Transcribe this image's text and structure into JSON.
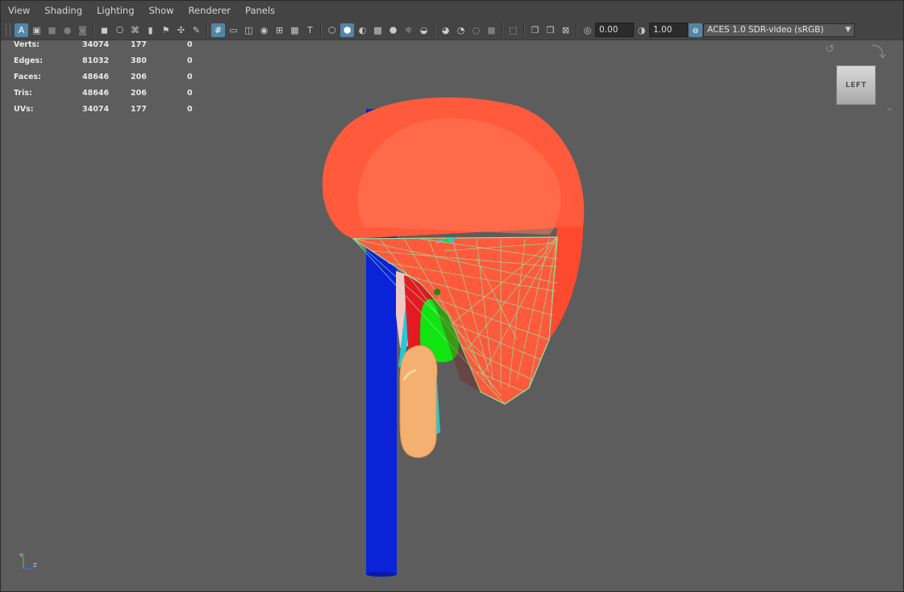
{
  "menu": [
    "View",
    "Shading",
    "Lighting",
    "Show",
    "Renderer",
    "Panels"
  ],
  "toolbar": {
    "exposure": "0.00",
    "gamma": "1.00",
    "color_space": "ACES 1.0 SDR-video (sRGB)"
  },
  "hud": {
    "rows": [
      {
        "label": "Verts:",
        "total": "34074",
        "selected": "177",
        "third": "0"
      },
      {
        "label": "Edges:",
        "total": "81032",
        "selected": "380",
        "third": "0"
      },
      {
        "label": "Faces:",
        "total": "48646",
        "selected": "206",
        "third": "0"
      },
      {
        "label": "Tris:",
        "total": "48646",
        "selected": "206",
        "third": "0"
      },
      {
        "label": "UVs:",
        "total": "34074",
        "selected": "177",
        "third": "0"
      }
    ]
  },
  "viewcube": {
    "label": "LEFT"
  },
  "axis": {
    "y": "Y",
    "z": "Z"
  },
  "colors": {
    "viewport_bg": "#5d5d5d",
    "highlight": "#5285a6",
    "pole": "#0a22d8",
    "dome": "#ff5a3c",
    "wire": "#8fe8a2",
    "green": "#11e411",
    "tan": "#f4b070",
    "cyan": "#25c8d8"
  }
}
